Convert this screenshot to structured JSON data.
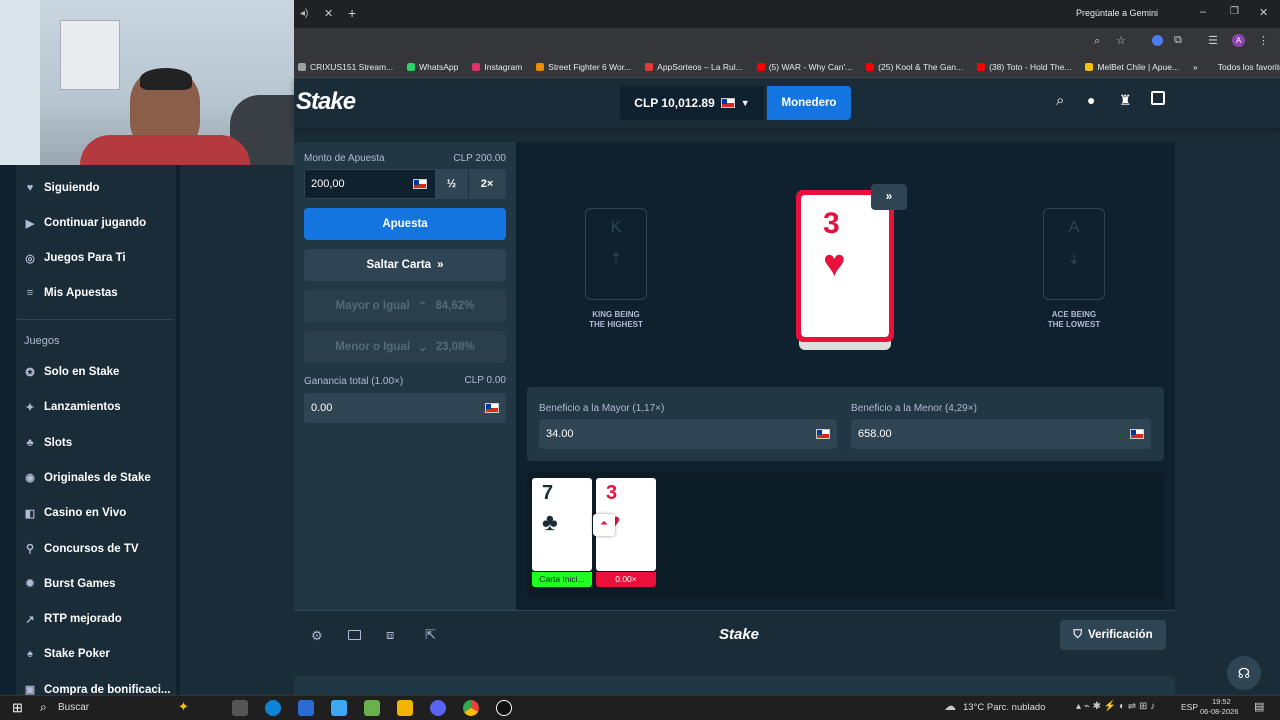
{
  "browser": {
    "tab_right_label": "Pregúntale a Gemini",
    "bookmarks": [
      {
        "label": "CRIXUS151 Stream...",
        "color": "#9aa0a6"
      },
      {
        "label": "WhatsApp",
        "color": "#25d366"
      },
      {
        "label": "Instagram",
        "color": "#e1306c"
      },
      {
        "label": "Street Fighter 6 Wor...",
        "color": "#f28b00"
      },
      {
        "label": "AppSorteos – La Rul...",
        "color": "#e53935"
      },
      {
        "label": "(5) WAR - Why Can'...",
        "color": "#ff0000"
      },
      {
        "label": "(25) Kool & The Gan...",
        "color": "#ff0000"
      },
      {
        "label": "(38) Toto - Hold The...",
        "color": "#ff0000"
      },
      {
        "label": "MelBet Chile | Apue...",
        "color": "#f4c20d"
      }
    ],
    "all_favorites": "Todos los favoritos"
  },
  "header": {
    "logo": "Stake",
    "balance": "CLP 10,012.89",
    "wallet_button": "Monedero"
  },
  "sidebar": {
    "items": [
      {
        "label": "Siguiendo",
        "icon": "heart-icon",
        "glyph": "♥"
      },
      {
        "label": "Continuar jugando",
        "icon": "play-icon",
        "glyph": "▶"
      },
      {
        "label": "Juegos Para Ti",
        "icon": "target-icon",
        "glyph": "◎"
      },
      {
        "label": "Mis Apuestas",
        "icon": "list-icon",
        "glyph": "≡"
      }
    ],
    "section_label": "Juegos",
    "game_items": [
      {
        "label": "Solo en Stake",
        "icon": "star-icon",
        "glyph": "✪"
      },
      {
        "label": "Lanzamientos",
        "icon": "sparkle-icon",
        "glyph": "✦"
      },
      {
        "label": "Slots",
        "icon": "slots-icon",
        "glyph": "♣"
      },
      {
        "label": "Originales de Stake",
        "icon": "stake-icon",
        "glyph": "◉"
      },
      {
        "label": "Casino en Vivo",
        "icon": "live-icon",
        "glyph": "◧"
      },
      {
        "label": "Concursos de TV",
        "icon": "tv-icon",
        "glyph": "⚲"
      },
      {
        "label": "Burst Games",
        "icon": "burst-icon",
        "glyph": "✹"
      },
      {
        "label": "RTP mejorado",
        "icon": "chart-icon",
        "glyph": "↗"
      },
      {
        "label": "Stake Poker",
        "icon": "poker-icon",
        "glyph": "♠"
      },
      {
        "label": "Compra de bonificaci...",
        "icon": "gift-icon",
        "glyph": "▣"
      }
    ]
  },
  "controls": {
    "bet_label": "Monto de Apuesta",
    "bet_currency_value": "CLP 200.00",
    "bet_value": "200,00",
    "half_label": "½",
    "double_label": "2×",
    "bet_button": "Apuesta",
    "skip_button": "Saltar Carta",
    "higher_label": "Mayor o Igual",
    "higher_pct": "84,62%",
    "lower_label": "Menor o Igual",
    "lower_pct": "23,08%",
    "profit_label": "Ganancia total (1.00×)",
    "profit_currency_value": "CLP 0.00",
    "profit_value": "0.00"
  },
  "game": {
    "left_ghost_letter": "K",
    "left_caption_line1": "KING BEING",
    "left_caption_line2": "THE HIGHEST",
    "right_ghost_letter": "A",
    "right_caption_line1": "ACE BEING",
    "right_caption_line2": "THE LOWEST",
    "current_card_rank": "3",
    "current_card_suit": "♥",
    "profit_higher_label": "Beneficio a la Mayor (1,17×)",
    "profit_higher_value": "34.00",
    "profit_lower_label": "Beneficio a la Menor (4,29×)",
    "profit_lower_value": "658.00",
    "history": [
      {
        "rank": "7",
        "suit": "♣",
        "color": "#1a2c38",
        "tag": "Carta Inici...",
        "tag_color": "#1fff20"
      },
      {
        "rank": "3",
        "suit": "♥",
        "color": "#e9113c",
        "tag": "0.00×",
        "tag_color": "#e9113c"
      }
    ]
  },
  "footer": {
    "logo": "Stake",
    "verify_button": "Verificación"
  },
  "taskbar": {
    "search": "Buscar",
    "weather": "13°C  Parc. nublado",
    "lang": "ESP",
    "time": "19:52",
    "date": "06-08-2026"
  },
  "colors": {
    "accent_blue": "#1475e1",
    "card_red": "#e9113c",
    "green": "#1fff20"
  }
}
